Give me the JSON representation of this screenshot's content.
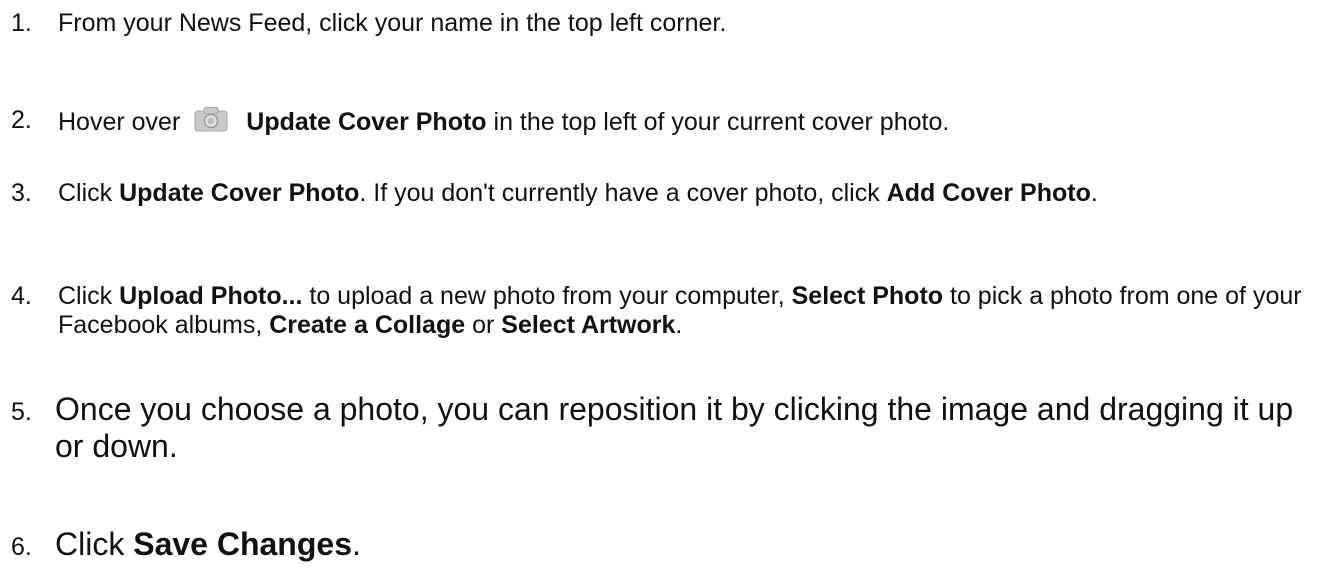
{
  "steps": [
    {
      "number": "1.",
      "text": "From your News Feed, click your name in the top left corner."
    },
    {
      "number": "2.",
      "pre": "Hover over",
      "icon": "camera-icon",
      "bold": "Update Cover Photo",
      "post": " in the top left of your current cover photo."
    },
    {
      "number": "3.",
      "pre": "Click ",
      "bold1": "Update Cover Photo",
      "mid": ". If you don't currently have a cover photo, click ",
      "bold2": "Add Cover Photo",
      "post": "."
    },
    {
      "number": "4.",
      "pre": "Click ",
      "bold1": "Upload Photo...",
      "mid1": " to upload a new photo from your computer, ",
      "bold2": "Select Photo",
      "mid2": " to pick a photo from one of your Facebook albums, ",
      "bold3": "Create a Collage",
      "mid3": " or ",
      "bold4": "Select Artwork",
      "post": "."
    },
    {
      "number": "5.",
      "text": "Once you choose a photo, you can reposition it by clicking the image and dragging it up or down."
    },
    {
      "number": "6.",
      "pre": "Click ",
      "bold": "Save Changes",
      "post": "."
    }
  ]
}
